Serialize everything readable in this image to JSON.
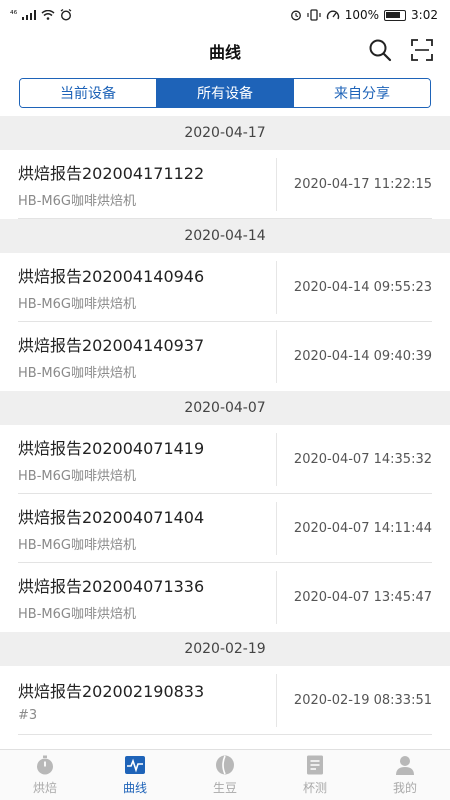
{
  "status_bar": {
    "signal_text": "⁴⁶",
    "battery_percent": "100%",
    "time": "3:02"
  },
  "header": {
    "title": "曲线"
  },
  "segments": [
    {
      "label": "当前设备",
      "active": false
    },
    {
      "label": "所有设备",
      "active": true
    },
    {
      "label": "来自分享",
      "active": false
    }
  ],
  "groups": [
    {
      "date": "2020-04-17",
      "items": [
        {
          "title": "烘焙报告202004171122",
          "subtitle": "HB-M6G咖啡烘焙机",
          "time": "2020-04-17 11:22:15"
        }
      ]
    },
    {
      "date": "2020-04-14",
      "items": [
        {
          "title": "烘焙报告202004140946",
          "subtitle": "HB-M6G咖啡烘焙机",
          "time": "2020-04-14 09:55:23"
        },
        {
          "title": "烘焙报告202004140937",
          "subtitle": "HB-M6G咖啡烘焙机",
          "time": "2020-04-14 09:40:39"
        }
      ]
    },
    {
      "date": "2020-04-07",
      "items": [
        {
          "title": "烘焙报告202004071419",
          "subtitle": "HB-M6G咖啡烘焙机",
          "time": "2020-04-07 14:35:32"
        },
        {
          "title": "烘焙报告202004071404",
          "subtitle": "HB-M6G咖啡烘焙机",
          "time": "2020-04-07 14:11:44"
        },
        {
          "title": "烘焙报告202004071336",
          "subtitle": "HB-M6G咖啡烘焙机",
          "time": "2020-04-07 13:45:47"
        }
      ]
    },
    {
      "date": "2020-02-19",
      "items": [
        {
          "title": "烘焙报告202002190833",
          "subtitle": "#3",
          "time": "2020-02-19 08:33:51"
        }
      ]
    }
  ],
  "tabbar": [
    {
      "label": "烘焙",
      "icon": "timer-icon",
      "active": false
    },
    {
      "label": "曲线",
      "icon": "chart-icon",
      "active": true
    },
    {
      "label": "生豆",
      "icon": "bean-icon",
      "active": false
    },
    {
      "label": "杯测",
      "icon": "document-icon",
      "active": false
    },
    {
      "label": "我的",
      "icon": "person-icon",
      "active": false
    }
  ],
  "colors": {
    "accent": "#1e63b8",
    "inactive_tab": "#a9a9a9",
    "section_bg": "#efefef"
  }
}
